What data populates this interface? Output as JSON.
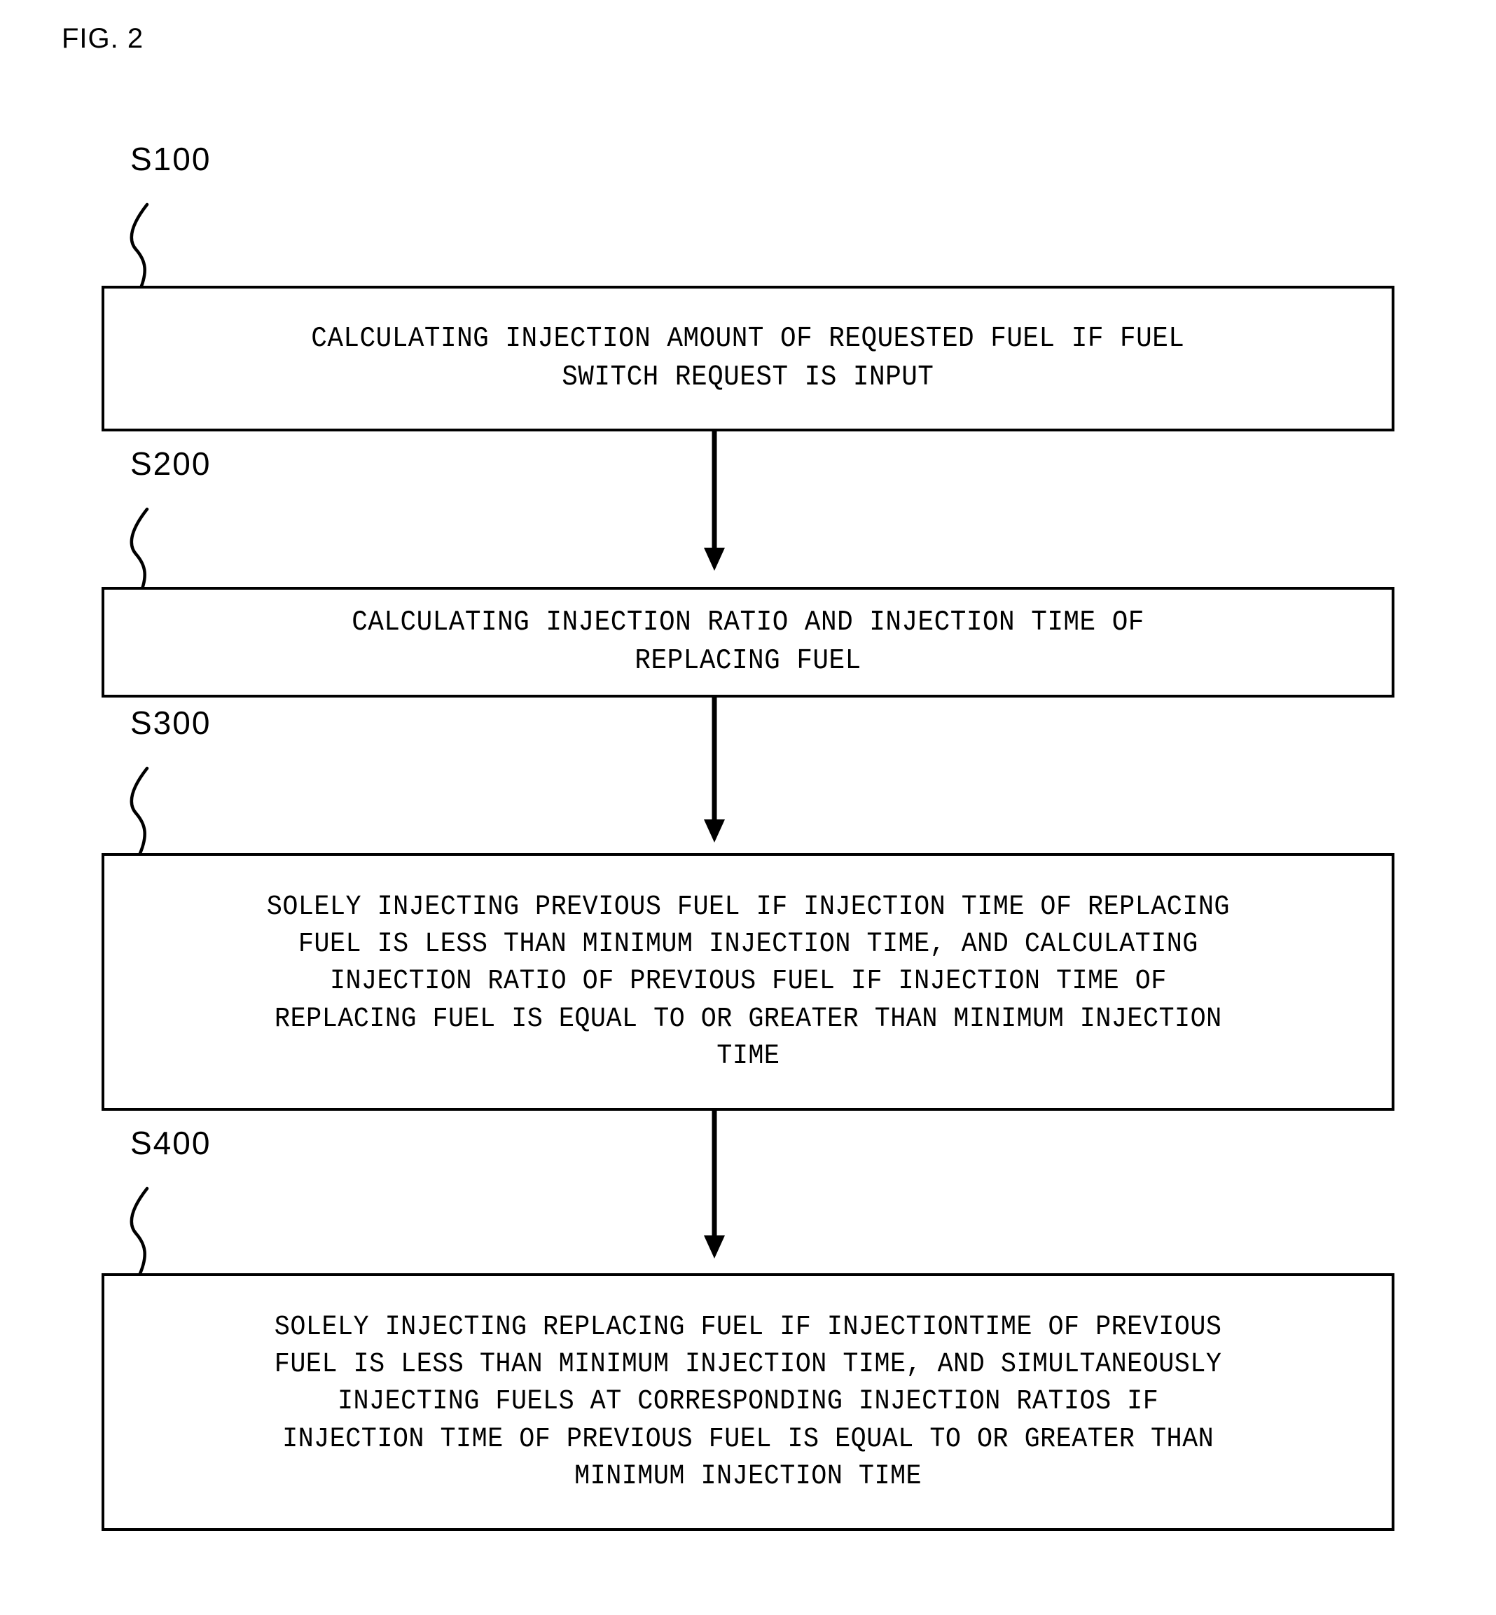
{
  "figure": {
    "title": "FIG. 2"
  },
  "colors": {
    "stroke": "#000000",
    "background": "#ffffff"
  },
  "flowchart": {
    "type": "flowchart",
    "orientation": "vertical",
    "steps": [
      {
        "ref": "S100",
        "text": "CALCULATING INJECTION AMOUNT OF REQUESTED FUEL IF FUEL\nSWITCH REQUEST IS INPUT"
      },
      {
        "ref": "S200",
        "text": "CALCULATING INJECTION RATIO AND INJECTION TIME OF\nREPLACING FUEL"
      },
      {
        "ref": "S300",
        "text": "SOLELY INJECTING PREVIOUS FUEL IF INJECTION TIME OF REPLACING\nFUEL IS LESS THAN MINIMUM INJECTION TIME, AND CALCULATING\nINJECTION RATIO OF PREVIOUS FUEL IF INJECTION TIME OF\nREPLACING FUEL IS EQUAL TO OR GREATER THAN MINIMUM INJECTION\nTIME"
      },
      {
        "ref": "S400",
        "text": "SOLELY INJECTING REPLACING FUEL IF INJECTIONTIME OF PREVIOUS\nFUEL IS LESS THAN MINIMUM INJECTION TIME, AND SIMULTANEOUSLY\nINJECTING FUELS AT CORRESPONDING INJECTION RATIOS IF\nINJECTION TIME OF PREVIOUS FUEL IS EQUAL TO OR GREATER THAN\nMINIMUM INJECTION TIME"
      }
    ],
    "connectors": [
      {
        "from": "S100",
        "to": "S200",
        "style": "arrow-down"
      },
      {
        "from": "S200",
        "to": "S300",
        "style": "arrow-down"
      },
      {
        "from": "S300",
        "to": "S400",
        "style": "arrow-down"
      }
    ]
  }
}
